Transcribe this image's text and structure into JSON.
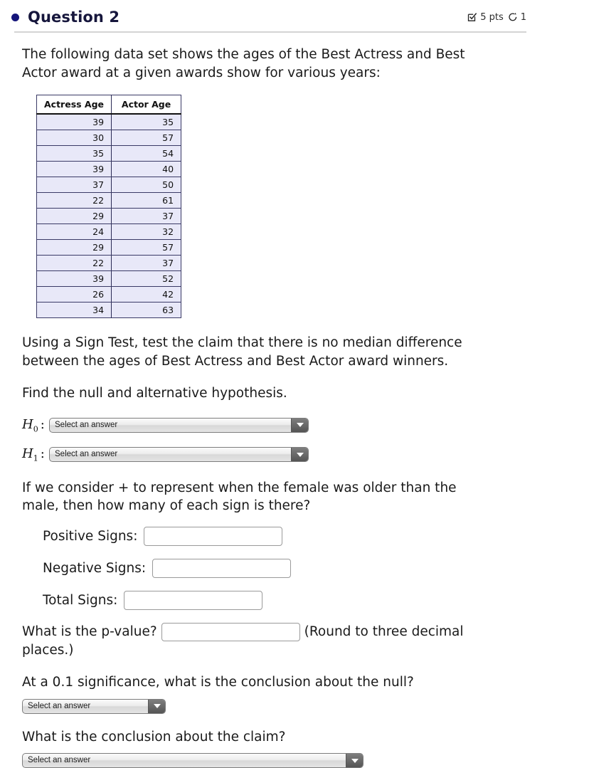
{
  "header": {
    "title": "Question 2",
    "bullet_color": "#15157a",
    "points": "5 pts",
    "attempts": "1",
    "points_icon": "checkbox-checked-icon",
    "attempts_icon": "retry-icon"
  },
  "content": {
    "intro": "The following data set shows the ages of the Best Actress and Best Actor award at a given awards show for various years:",
    "instruction": "Using a Sign Test, test the claim that there is no median difference between the ages of Best Actress and Best Actor award winners.",
    "find_hypothesis": "Find the null and alternative hypothesis.",
    "sign_question": "If we consider + to represent when the female was older than the male, then how many of each sign is there?",
    "pvalue_question": "What is the p-value?",
    "pvalue_note": "(Round to three decimal",
    "pvalue_note_2": "places.)",
    "null_conclusion_question": "At a 0.1 significance, what is the conclusion about the null?",
    "claim_conclusion_question": "What is the conclusion about the claim?"
  },
  "table": {
    "headers": [
      "Actress Age",
      "Actor Age"
    ],
    "rows": [
      [
        "39",
        "35"
      ],
      [
        "30",
        "57"
      ],
      [
        "35",
        "54"
      ],
      [
        "39",
        "40"
      ],
      [
        "37",
        "50"
      ],
      [
        "22",
        "61"
      ],
      [
        "29",
        "37"
      ],
      [
        "24",
        "32"
      ],
      [
        "29",
        "57"
      ],
      [
        "22",
        "37"
      ],
      [
        "39",
        "52"
      ],
      [
        "26",
        "42"
      ],
      [
        "34",
        "63"
      ]
    ],
    "header_bg": "#ffffff",
    "row_bg": "#e8e8f8",
    "border_color": "#3a3a66"
  },
  "hypotheses": {
    "h0_label": "H",
    "h0_sub": "0",
    "h1_label": "H",
    "h1_sub": "1",
    "colon": ":",
    "h0_value": "Select an answer",
    "h1_value": "Select an answer"
  },
  "signs": {
    "positive_label": "Positive Signs:",
    "positive_value": "",
    "negative_label": "Negative Signs:",
    "negative_value": "",
    "total_label": "Total Signs:",
    "total_value": ""
  },
  "pvalue": {
    "value": ""
  },
  "conclusions": {
    "null_value": "Select an answer",
    "claim_value": "Select an answer"
  }
}
